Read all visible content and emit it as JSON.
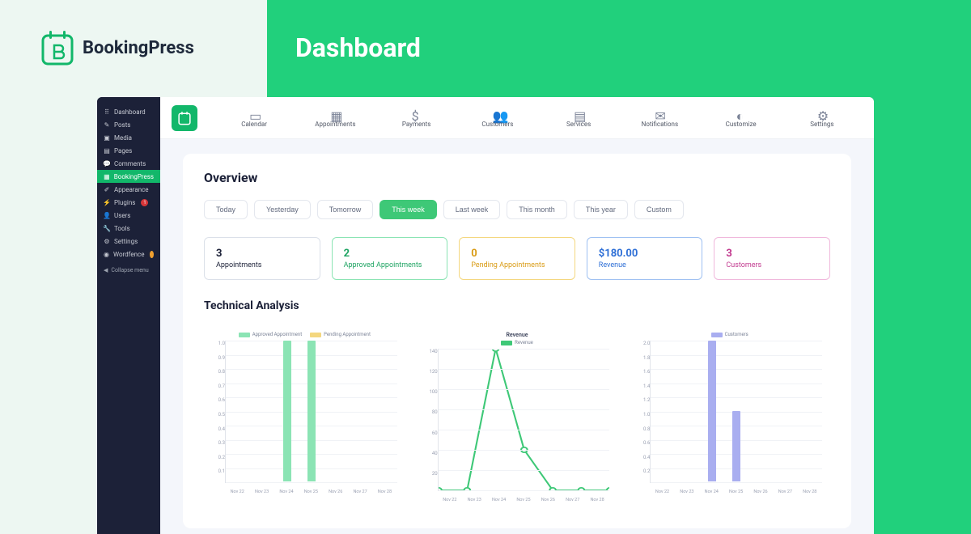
{
  "brand": "BookingPress",
  "page_title": "Dashboard",
  "wp_sidebar": {
    "items": [
      {
        "icon": "dashboard",
        "label": "Dashboard"
      },
      {
        "icon": "pin",
        "label": "Posts"
      },
      {
        "icon": "media",
        "label": "Media"
      },
      {
        "icon": "page",
        "label": "Pages"
      },
      {
        "icon": "comment",
        "label": "Comments"
      },
      {
        "icon": "bp",
        "label": "BookingPress",
        "active": true
      },
      {
        "icon": "brush",
        "label": "Appearance"
      },
      {
        "icon": "plug",
        "label": "Plugins",
        "badge": "1"
      },
      {
        "icon": "user",
        "label": "Users"
      },
      {
        "icon": "wrench",
        "label": "Tools"
      },
      {
        "icon": "gear",
        "label": "Settings"
      },
      {
        "icon": "shield",
        "label": "Wordfence",
        "badge_orange": true
      }
    ],
    "collapse": "Collapse menu"
  },
  "top_nav": [
    {
      "icon": "calendar",
      "label": "Calendar"
    },
    {
      "icon": "appointments",
      "label": "Appointments"
    },
    {
      "icon": "payments",
      "label": "Payments"
    },
    {
      "icon": "customers",
      "label": "Customers"
    },
    {
      "icon": "services",
      "label": "Services"
    },
    {
      "icon": "notifications",
      "label": "Notifications"
    },
    {
      "icon": "customize",
      "label": "Customize"
    },
    {
      "icon": "settings",
      "label": "Settings"
    }
  ],
  "overview": {
    "title": "Overview",
    "filters": [
      "Today",
      "Yesterday",
      "Tomorrow",
      "This week",
      "Last week",
      "This month",
      "This year",
      "Custom"
    ],
    "active_filter": 3,
    "stats": [
      {
        "value": "3",
        "label": "Appointments",
        "tone": "grey"
      },
      {
        "value": "2",
        "label": "Approved Appointments",
        "tone": "green"
      },
      {
        "value": "0",
        "label": "Pending Appointments",
        "tone": "yellow"
      },
      {
        "value": "$180.00",
        "label": "Revenue",
        "tone": "blue"
      },
      {
        "value": "3",
        "label": "Customers",
        "tone": "pink"
      }
    ]
  },
  "technical_analysis": {
    "title": "Technical Analysis"
  },
  "chart_data": [
    {
      "type": "bar",
      "title": "",
      "series": [
        {
          "name": "Approved Appointment",
          "color": "#8be4b4",
          "values": [
            0,
            0,
            1,
            1,
            0,
            0,
            0
          ]
        },
        {
          "name": "Pending Appointment",
          "color": "#f4d77f",
          "values": [
            0,
            0,
            0,
            0,
            0,
            0,
            0
          ]
        }
      ],
      "categories": [
        "Nov 22",
        "Nov 23",
        "Nov 24",
        "Nov 25",
        "Nov 26",
        "Nov 27",
        "Nov 28"
      ],
      "y_ticks": [
        "1.0",
        "0.9",
        "0.8",
        "0.7",
        "0.6",
        "0.5",
        "0.4",
        "0.3",
        "0.2",
        "0.1",
        ""
      ],
      "ylim": [
        0,
        1.0
      ]
    },
    {
      "type": "line",
      "title": "Revenue",
      "series": [
        {
          "name": "Revenue",
          "color": "#3ec877",
          "values": [
            0,
            0,
            140,
            40,
            0,
            0,
            0
          ]
        }
      ],
      "categories": [
        "Nov 22",
        "Nov 23",
        "Nov 24",
        "Nov 25",
        "Nov 26",
        "Nov 27",
        "Nov 28"
      ],
      "y_ticks": [
        "140",
        "120",
        "100",
        "80",
        "60",
        "40",
        "20",
        ""
      ],
      "ylim": [
        0,
        140
      ]
    },
    {
      "type": "bar",
      "title": "",
      "series": [
        {
          "name": "Customers",
          "color": "#a9aef0",
          "values": [
            0,
            0,
            2,
            1,
            0,
            0,
            0
          ]
        }
      ],
      "categories": [
        "Nov 22",
        "Nov 23",
        "Nov 24",
        "Nov 25",
        "Nov 26",
        "Nov 27",
        "Nov 28"
      ],
      "y_ticks": [
        "2.0",
        "1.8",
        "1.6",
        "1.4",
        "1.2",
        "1.0",
        "0.8",
        "0.6",
        "0.4",
        "0.2",
        ""
      ],
      "ylim": [
        0,
        2.0
      ]
    }
  ]
}
